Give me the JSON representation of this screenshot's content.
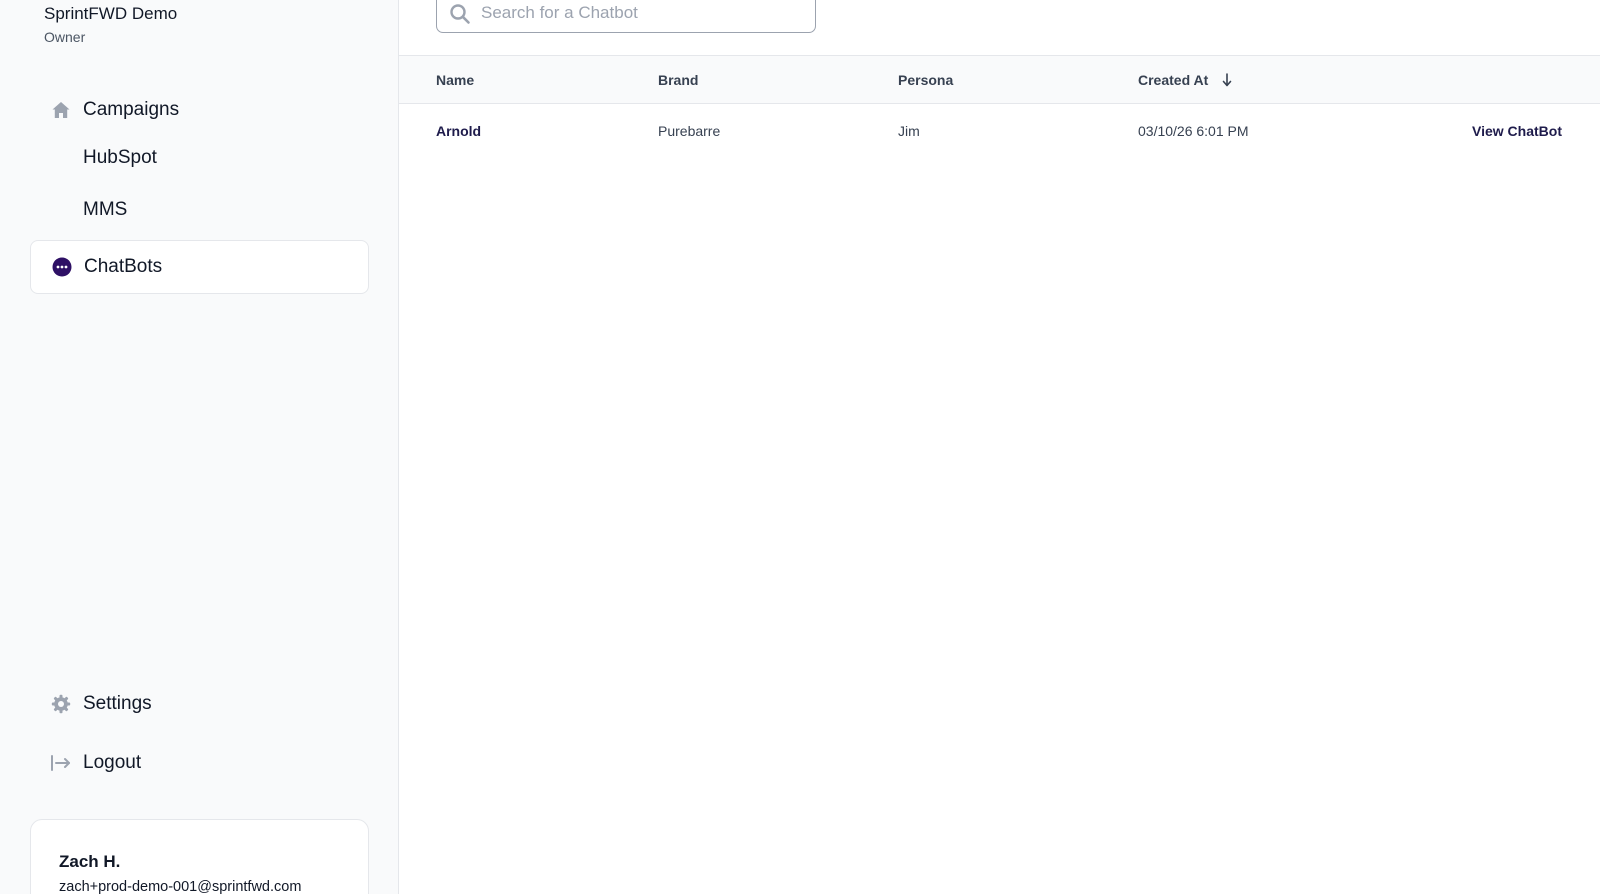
{
  "org": {
    "name": "SprintFWD Demo",
    "role": "Owner"
  },
  "nav": {
    "campaigns": "Campaigns",
    "hubspot": "HubSpot",
    "mms": "MMS",
    "chatbots": "ChatBots",
    "settings": "Settings",
    "logout": "Logout"
  },
  "user": {
    "name": "Zach H.",
    "email": "zach+prod-demo-001@sprintfwd.com"
  },
  "search": {
    "placeholder": "Search for a Chatbot",
    "value": ""
  },
  "table": {
    "headers": {
      "name": "Name",
      "brand": "Brand",
      "persona": "Persona",
      "created_at": "Created At"
    },
    "sort": {
      "column": "created_at",
      "direction": "descending"
    },
    "rows": [
      {
        "name": "Arnold",
        "brand": "Purebarre",
        "persona": "Jim",
        "created_at": "03/10/26 6:01 PM",
        "action": "View ChatBot"
      }
    ]
  },
  "colors": {
    "accent": "#2e1065",
    "sidebar_bg": "#f9fafb",
    "icon_gray": "#9ca3af"
  }
}
